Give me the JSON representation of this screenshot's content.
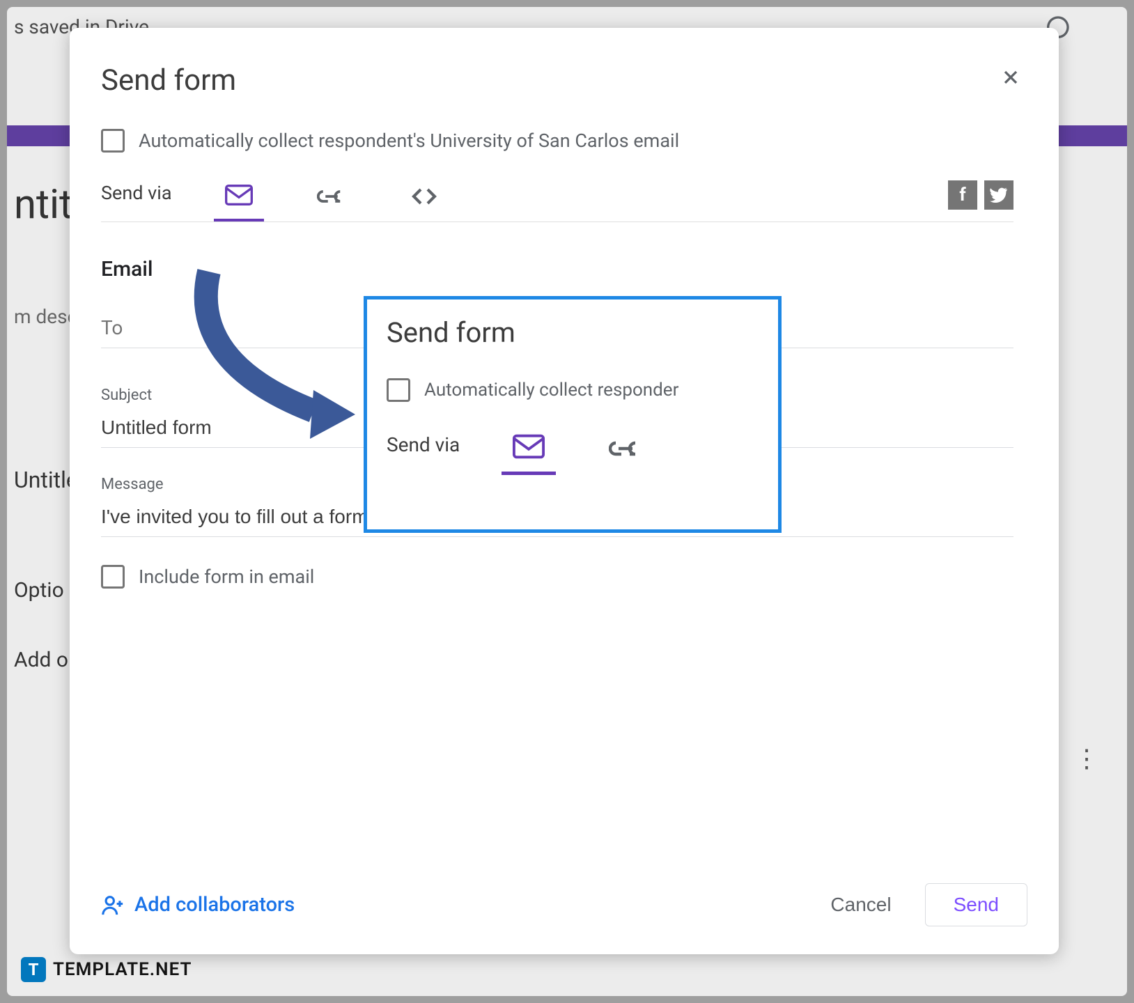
{
  "background": {
    "saved_text": "s saved in Drive",
    "title_fragment": "ntit",
    "desc_fragment": "m desc",
    "untitled_fragment": "Untitle",
    "option_fragment": "Optio",
    "add_fragment": "Add o"
  },
  "modal": {
    "title": "Send form",
    "auto_collect_label": "Automatically collect respondent's University of San Carlos email",
    "send_via_label": "Send via",
    "email_section_title": "Email",
    "to_label": "To",
    "subject_label": "Subject",
    "subject_value": "Untitled form",
    "message_label": "Message",
    "message_value": "I've invited you to fill out a form:",
    "include_form_label": "Include form in email",
    "add_collaborators": "Add collaborators",
    "cancel": "Cancel",
    "send": "Send"
  },
  "callout": {
    "title": "Send form",
    "auto_collect_label": "Automatically collect responder",
    "send_via_label": "Send via"
  },
  "watermark": {
    "icon_letter": "T",
    "text": "TEMPLATE.NET"
  },
  "social": {
    "fb": "f",
    "tw": "t"
  }
}
